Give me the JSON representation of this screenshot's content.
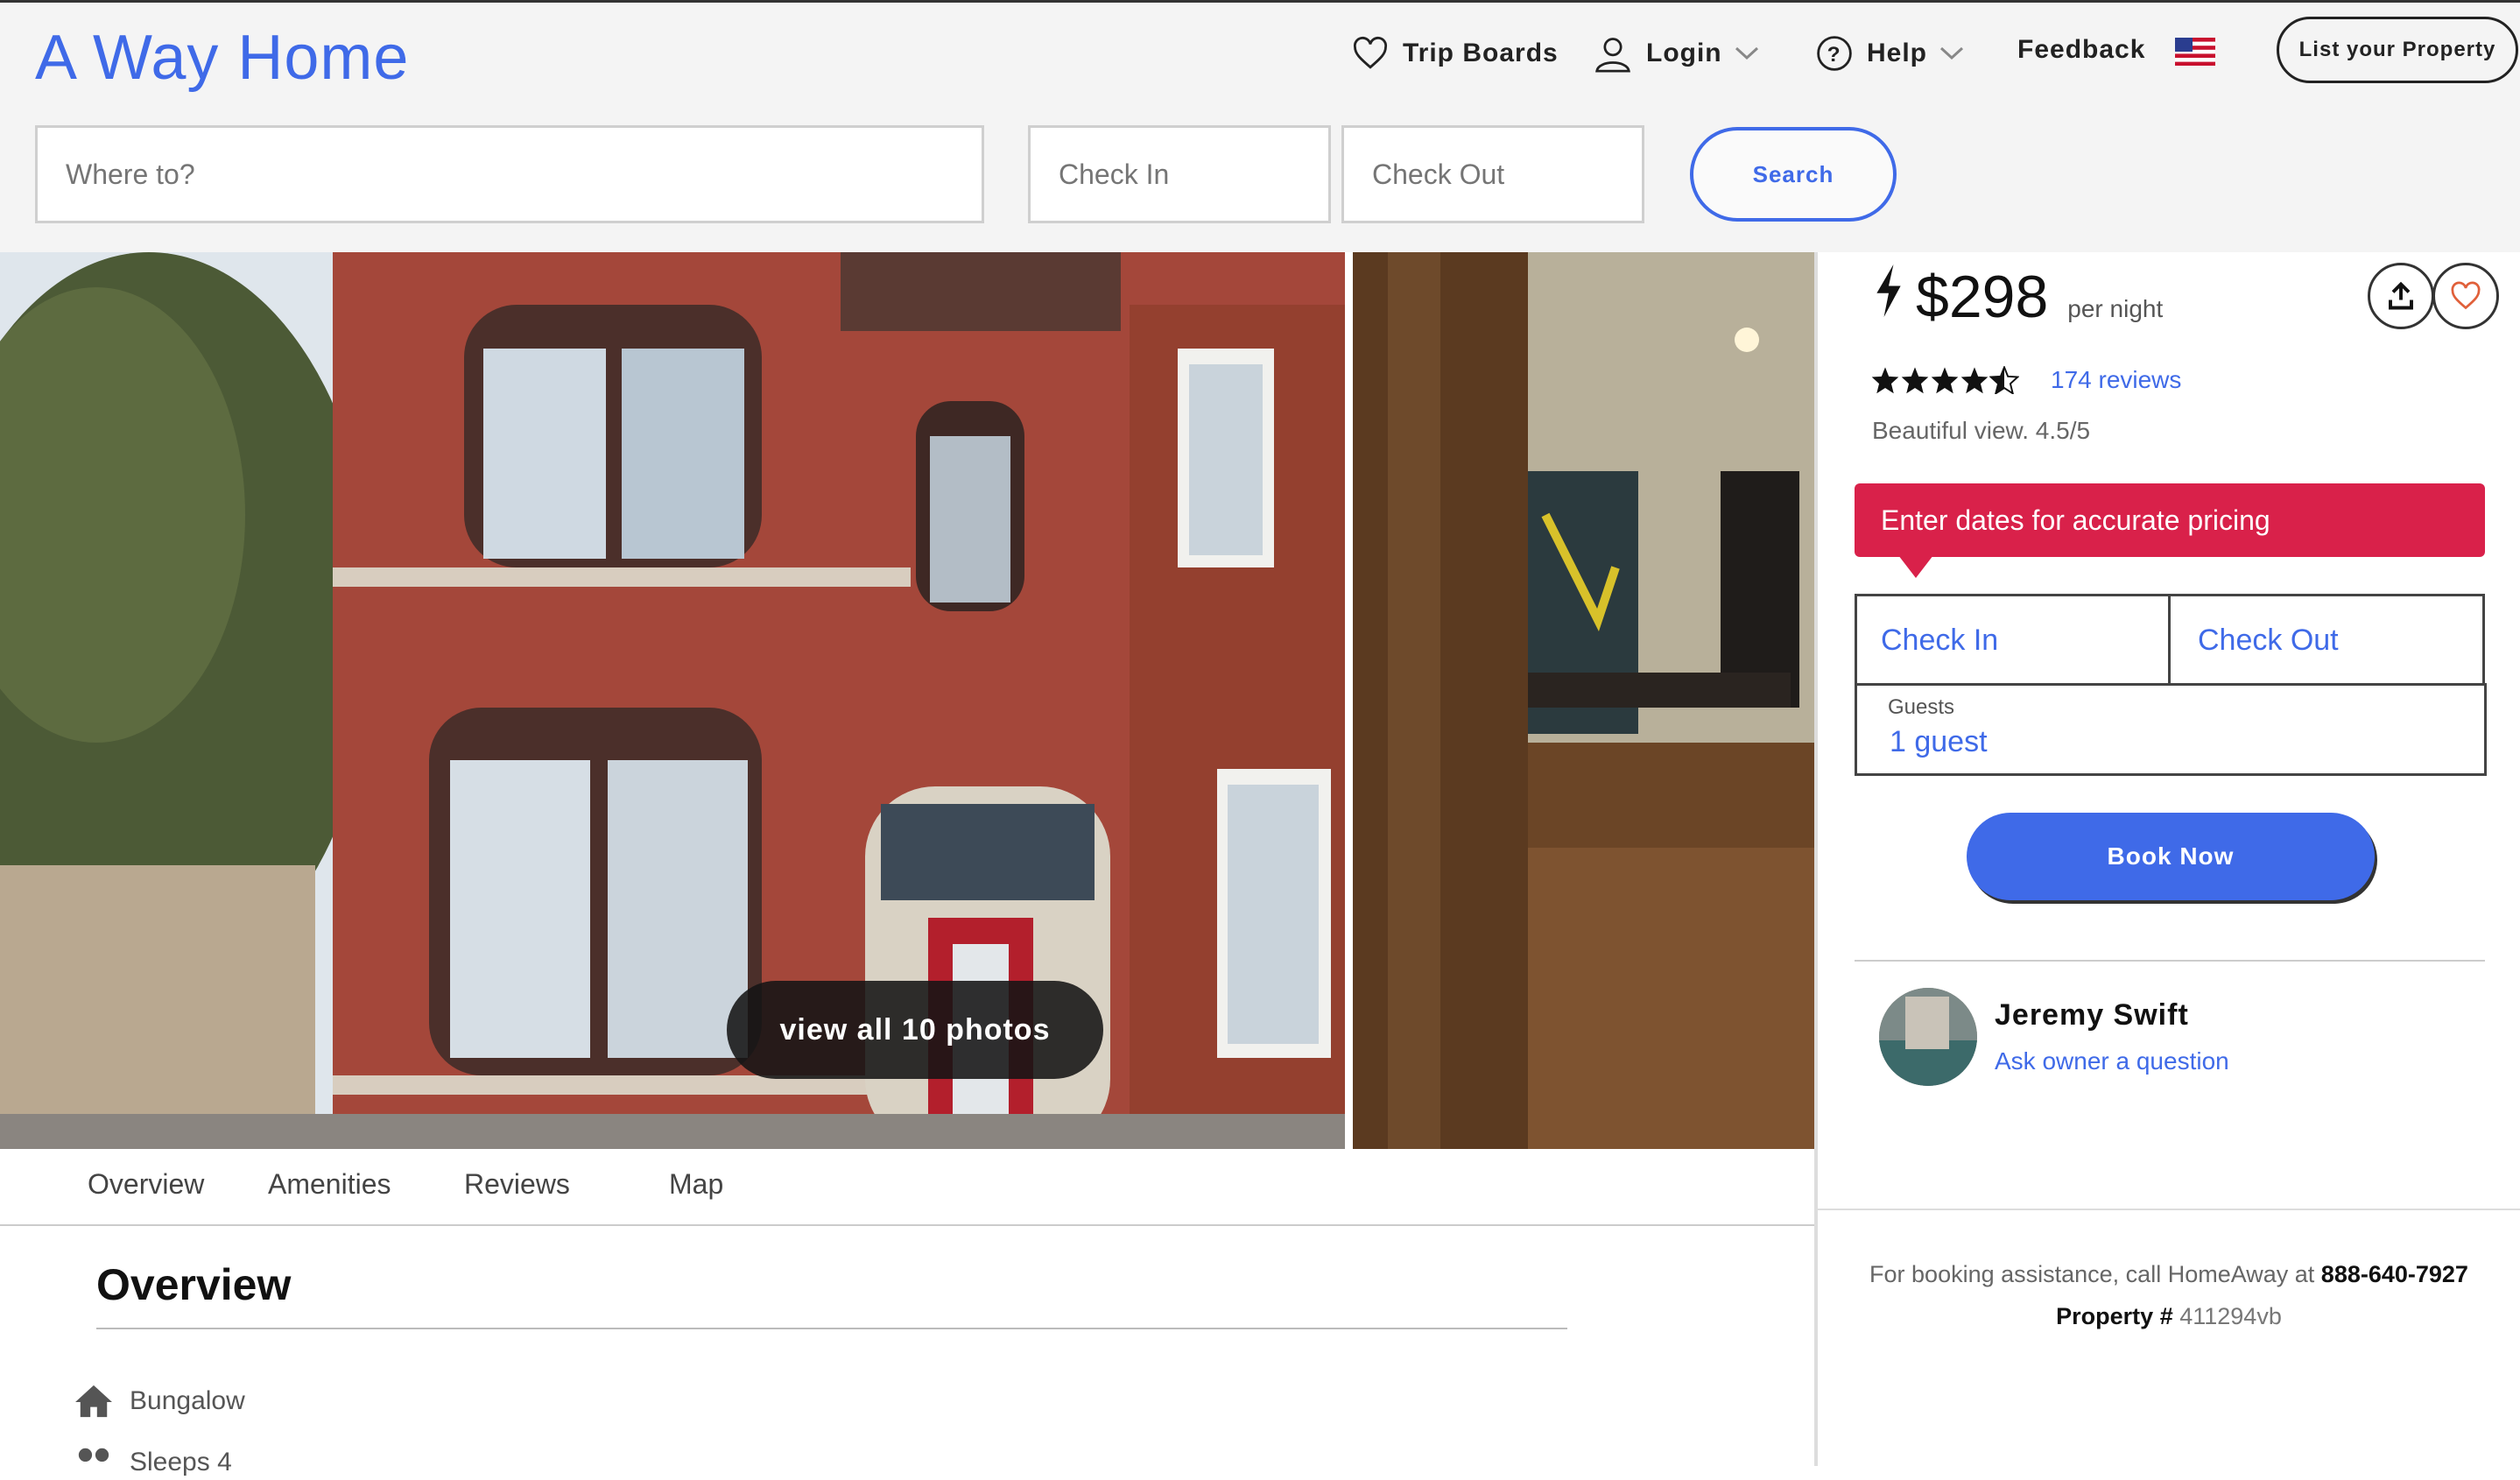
{
  "header": {
    "logo": "A Way Home",
    "nav": {
      "trip_boards": "Trip Boards",
      "login": "Login",
      "help": "Help",
      "feedback": "Feedback",
      "list_property": "List your Property"
    },
    "search": {
      "where_placeholder": "Where to?",
      "checkin_placeholder": "Check In",
      "checkout_placeholder": "Check Out",
      "button": "Search"
    }
  },
  "gallery": {
    "view_all": "view all 10 photos"
  },
  "tabs": [
    "Overview",
    "Amenities",
    "Reviews",
    "Map"
  ],
  "overview": {
    "title": "Overview",
    "features": [
      "Bungalow",
      "Sleeps 4"
    ]
  },
  "booking": {
    "price": "$298",
    "price_unit": "per night",
    "rating": 4.5,
    "reviews": "174 reviews",
    "rating_note": "Beautiful view.  4.5/5",
    "banner": "Enter dates for accurate pricing",
    "check_in": "Check In",
    "check_out": "Check Out",
    "guests_label": "Guests",
    "guests_value": "1 guest",
    "book_now": "Book Now"
  },
  "owner": {
    "name": "Jeremy Swift",
    "ask": "Ask owner a question"
  },
  "assistance": {
    "text": "For booking assistance, call HomeAway at",
    "phone": "888-640-7927",
    "property_label": "Property #",
    "property_number": "411294vb"
  },
  "colors": {
    "accent": "#3f6ae8",
    "banner": "#d9214a"
  }
}
